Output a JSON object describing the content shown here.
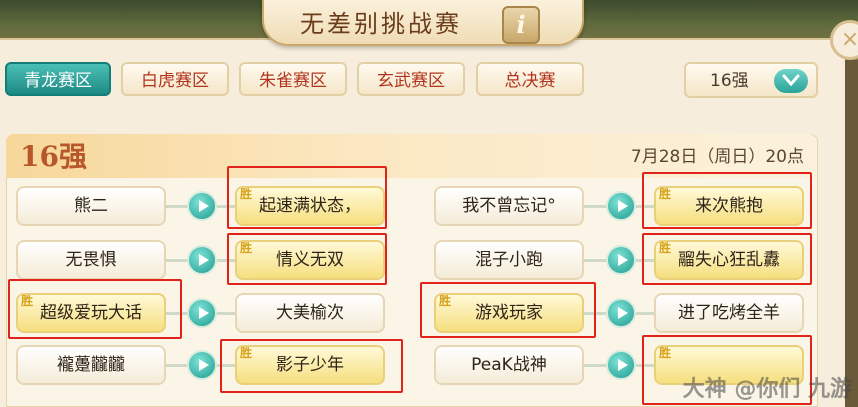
{
  "window": {
    "title": "无差别挑战赛",
    "info_label": "i",
    "close_label": "×"
  },
  "tabs": [
    {
      "label": "青龙赛区",
      "active": true
    },
    {
      "label": "白虎赛区",
      "active": false
    },
    {
      "label": "朱雀赛区",
      "active": false
    },
    {
      "label": "玄武赛区",
      "active": false
    },
    {
      "label": "总决赛",
      "active": false
    }
  ],
  "round_select": {
    "value": "16强"
  },
  "bracket": {
    "round_label": "16强",
    "schedule": "7月28日（周日）20点",
    "win_tag": "胜",
    "left": [
      {
        "a": "熊二",
        "b": "起速满状态，",
        "winner": "b"
      },
      {
        "a": "无畏惧",
        "b": "情义无双",
        "winner": "b"
      },
      {
        "a": "超级爱玩大话",
        "b": "大美榆次",
        "winner": "a"
      },
      {
        "a": "襱躉龖龖",
        "b": "影子少年",
        "winner": "b"
      }
    ],
    "right": [
      {
        "a": "我不曾忘记°",
        "b": "来次熊抱",
        "winner": "b"
      },
      {
        "a": "混子小跑",
        "b": "鬸失心狂乱纛",
        "winner": "b"
      },
      {
        "a": "游戏玩家",
        "b": "进了吃烤全羊",
        "winner": "a"
      },
      {
        "a": "PeaK战神",
        "b": "",
        "winner": "b"
      }
    ]
  },
  "watermark": "大神 @你们  九游",
  "colors": {
    "accent": "#1e8b84",
    "tab_text": "#b2341d",
    "highlight": "#e2231a",
    "win_fill": "#f6df7e"
  }
}
